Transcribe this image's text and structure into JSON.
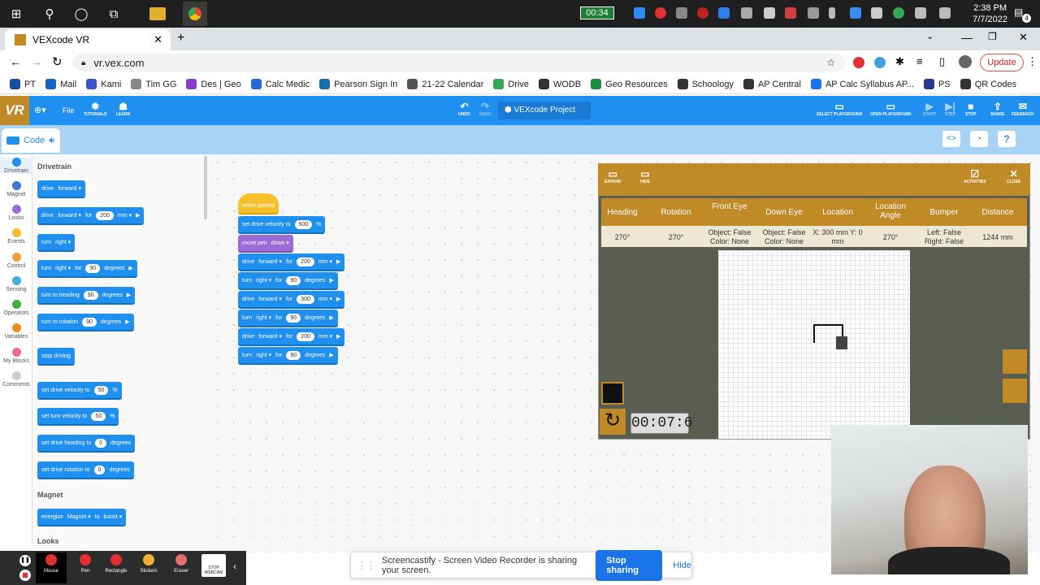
{
  "taskbar": {
    "meter": "00:34",
    "time": "2:38 PM",
    "date": "7/7/2022",
    "notif_count": "4"
  },
  "browser": {
    "tab_title": "VEXcode VR",
    "url": "vr.vex.com",
    "update_label": "Update"
  },
  "bookmarks": [
    {
      "label": "PT",
      "color": "#1a4fa0"
    },
    {
      "label": "Mail",
      "color": "#1464c8"
    },
    {
      "label": "Kami",
      "color": "#3a55c8"
    },
    {
      "label": "Tim GG",
      "color": "#888"
    },
    {
      "label": "Des | Geo",
      "color": "#8a3ac8"
    },
    {
      "label": "Calc Medic",
      "color": "#2a6ad8"
    },
    {
      "label": "Pearson Sign In",
      "color": "#1a6ea8"
    },
    {
      "label": "21-22 Calendar",
      "color": "#555"
    },
    {
      "label": "Drive",
      "color": "#34a853"
    },
    {
      "label": "WODB",
      "color": "#333"
    },
    {
      "label": "Geo Resources",
      "color": "#1e8e3e"
    },
    {
      "label": "Schoology",
      "color": "#333"
    },
    {
      "label": "AP Central",
      "color": "#333"
    },
    {
      "label": "AP Calc Syllabus AP...",
      "color": "#1a73e8"
    },
    {
      "label": "PS",
      "color": "#2a3a8a"
    },
    {
      "label": "QR Codes",
      "color": "#333"
    }
  ],
  "vex": {
    "logo": "VR",
    "file_label": "File",
    "tutorials": "TUTORIALS",
    "learn": "LEARN",
    "undo": "UNDO",
    "redo": "REDO",
    "project_name": "VEXcode Project",
    "select_playground": "SELECT PLAYGROUND",
    "open_playground": "OPEN PLAYGROUND",
    "start": "START",
    "step": "STEP",
    "stop": "STOP",
    "share": "SHARE",
    "feedback": "FEEDBACK",
    "code_tab": "Code"
  },
  "categories": [
    {
      "label": "Drivetrain",
      "color": "#1f8ff0"
    },
    {
      "label": "Magnet",
      "color": "#3a7ad0"
    },
    {
      "label": "Looks",
      "color": "#9b6bd8"
    },
    {
      "label": "Events",
      "color": "#f6c02d"
    },
    {
      "label": "Control",
      "color": "#f0a030"
    },
    {
      "label": "Sensing",
      "color": "#40b0d8"
    },
    {
      "label": "Operators",
      "color": "#40b040"
    },
    {
      "label": "Variables",
      "color": "#f08a20"
    },
    {
      "label": "My Blocks",
      "color": "#f06a8a"
    },
    {
      "label": "Comments",
      "color": "#cccccc"
    }
  ],
  "flyout": {
    "section1": "Drivetrain",
    "section2": "Magnet",
    "section3": "Looks",
    "blocks": [
      [
        "drive",
        "forward ▾"
      ],
      [
        "drive",
        "forward ▾",
        "for",
        "200",
        "mm ▾",
        "▶"
      ],
      [
        "turn",
        "right ▾"
      ],
      [
        "turn",
        "right ▾",
        "for",
        "90",
        "degrees",
        "▶"
      ],
      [
        "turn to heading",
        "90",
        "degrees",
        "▶"
      ],
      [
        "turn to rotation",
        "90",
        "degrees",
        "▶"
      ],
      [
        "stop driving"
      ],
      [
        "set drive velocity to",
        "50",
        "%"
      ],
      [
        "set turn velocity to",
        "50",
        "%"
      ],
      [
        "set drive heading to",
        "0",
        "degrees"
      ],
      [
        "set drive rotation to",
        "0",
        "degrees"
      ],
      [
        "energize",
        "Magnet ▾",
        "to",
        "boost ▾"
      ]
    ]
  },
  "script": {
    "hat": "when started",
    "blocks": [
      [
        "set drive velocity to",
        "500",
        "%"
      ],
      [
        "move pen",
        "down ▾"
      ],
      [
        "drive",
        "forward ▾",
        "for",
        "200",
        "mm ▾",
        "▶"
      ],
      [
        "turn",
        "right ▾",
        "for",
        "90",
        "degrees",
        "▶"
      ],
      [
        "drive",
        "forward ▾",
        "for",
        "300",
        "mm ▾",
        "▶"
      ],
      [
        "turn",
        "right ▾",
        "for",
        "90",
        "degrees",
        "▶"
      ],
      [
        "drive",
        "forward ▾",
        "for",
        "200",
        "mm ▾",
        "▶"
      ],
      [
        "turn",
        "right ▾",
        "for",
        "90",
        "degrees",
        "▶"
      ]
    ]
  },
  "playground": {
    "expand": "EXPAND",
    "hide": "HIDE",
    "activities": "ACTIVITIES",
    "close": "CLOSE",
    "headers": [
      "Heading",
      "Rotation",
      "Front Eye",
      "Down Eye",
      "Location",
      "Location Angle",
      "Bumper",
      "Distance"
    ],
    "values": [
      "270°",
      "270°",
      "Object: False Color: None",
      "Object: False Color: None",
      "X: 300 mm Y: 0 mm",
      "270°",
      "Left: False Right: False",
      "1244 mm"
    ],
    "timer": "00:07:6"
  },
  "screencastify": {
    "tools": [
      "Mouse",
      "Pen",
      "Rectangle",
      "Stickers",
      "Eraser",
      "STOP WEBCAM"
    ],
    "message": "Screencastify - Screen Video Recorder is sharing your screen.",
    "stop_sharing": "Stop sharing",
    "hide": "Hide"
  }
}
